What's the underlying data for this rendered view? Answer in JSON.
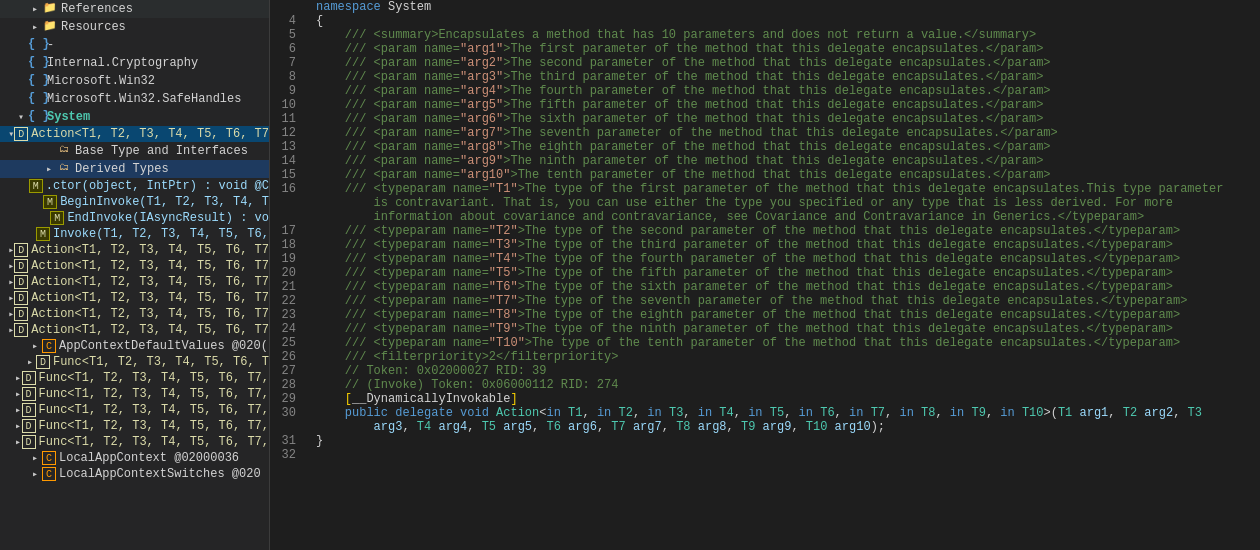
{
  "leftPanel": {
    "items": [
      {
        "id": "references",
        "label": "References",
        "indent": 2,
        "arrow": "collapsed",
        "icon": "folder",
        "iconColor": "folder"
      },
      {
        "id": "resources",
        "label": "Resources",
        "indent": 2,
        "arrow": "collapsed",
        "icon": "folder",
        "iconColor": "folder"
      },
      {
        "id": "braces1",
        "label": "{ } -",
        "indent": 1,
        "arrow": "leaf",
        "icon": "ns",
        "iconColor": "namespace"
      },
      {
        "id": "internal-crypto",
        "label": "Internal.Cryptography",
        "indent": 1,
        "arrow": "leaf",
        "icon": "ns",
        "iconColor": "namespace"
      },
      {
        "id": "microsoft-win32",
        "label": "Microsoft.Win32",
        "indent": 1,
        "arrow": "leaf",
        "icon": "ns",
        "iconColor": "namespace"
      },
      {
        "id": "microsoft-win32-safe",
        "label": "Microsoft.Win32.SafeHandles",
        "indent": 1,
        "arrow": "leaf",
        "icon": "ns",
        "iconColor": "namespace"
      },
      {
        "id": "system",
        "label": "System",
        "indent": 1,
        "arrow": "expanded",
        "icon": "ns",
        "iconColor": "namespace",
        "bold": true
      },
      {
        "id": "action-t10",
        "label": "Action<T1, T2, T3, T4, T5, T6, T7",
        "indent": 2,
        "arrow": "expanded",
        "icon": "delegate",
        "iconColor": "delegate",
        "selected": true
      },
      {
        "id": "base-type",
        "label": "Base Type and Interfaces",
        "indent": 3,
        "arrow": "leaf",
        "icon": "folder-sm",
        "iconColor": "folder"
      },
      {
        "id": "derived-types",
        "label": "Derived Types",
        "indent": 3,
        "arrow": "collapsed",
        "icon": "folder-sm",
        "iconColor": "folder",
        "selected-highlight": true
      },
      {
        "id": "ctor",
        "label": ".ctor(object, IntPtr) : void @C",
        "indent": 3,
        "arrow": "leaf",
        "icon": "method-blue",
        "iconColor": "method"
      },
      {
        "id": "begin-invoke",
        "label": "BeginInvoke(T1, T2, T3, T4, T",
        "indent": 3,
        "arrow": "leaf",
        "icon": "method-blue",
        "iconColor": "method"
      },
      {
        "id": "end-invoke",
        "label": "EndInvoke(IAsyncResult) : vo",
        "indent": 3,
        "arrow": "leaf",
        "icon": "method-blue",
        "iconColor": "method"
      },
      {
        "id": "invoke",
        "label": "Invoke(T1, T2, T3, T4, T5, T6,",
        "indent": 3,
        "arrow": "leaf",
        "icon": "method-blue",
        "iconColor": "method"
      },
      {
        "id": "action-t10b",
        "label": "Action<T1, T2, T3, T4, T5, T6, T7",
        "indent": 2,
        "arrow": "collapsed",
        "icon": "delegate",
        "iconColor": "delegate"
      },
      {
        "id": "action-t10c",
        "label": "Action<T1, T2, T3, T4, T5, T6, T7",
        "indent": 2,
        "arrow": "collapsed",
        "icon": "delegate",
        "iconColor": "delegate"
      },
      {
        "id": "action-t10d",
        "label": "Action<T1, T2, T3, T4, T5, T6, T7",
        "indent": 2,
        "arrow": "collapsed",
        "icon": "delegate",
        "iconColor": "delegate"
      },
      {
        "id": "action-t10e",
        "label": "Action<T1, T2, T3, T4, T5, T6, T7",
        "indent": 2,
        "arrow": "collapsed",
        "icon": "delegate",
        "iconColor": "delegate"
      },
      {
        "id": "action-t10f",
        "label": "Action<T1, T2, T3, T4, T5, T6, T7",
        "indent": 2,
        "arrow": "collapsed",
        "icon": "delegate",
        "iconColor": "delegate"
      },
      {
        "id": "action-t10g",
        "label": "Action<T1, T2, T3, T4, T5, T6, T7",
        "indent": 2,
        "arrow": "collapsed",
        "icon": "delegate",
        "iconColor": "delegate"
      },
      {
        "id": "app-context-values",
        "label": "AppContextDefaultValues @020(",
        "indent": 2,
        "arrow": "collapsed",
        "icon": "class-orange",
        "iconColor": "class"
      },
      {
        "id": "func-t10a",
        "label": "Func<T1, T2, T3, T4, T5, T6, T",
        "indent": 2,
        "arrow": "collapsed",
        "icon": "delegate",
        "iconColor": "delegate"
      },
      {
        "id": "func-t10b",
        "label": "Func<T1, T2, T3, T4, T5, T6, T7,",
        "indent": 2,
        "arrow": "collapsed",
        "icon": "delegate",
        "iconColor": "delegate"
      },
      {
        "id": "func-t10c",
        "label": "Func<T1, T2, T3, T4, T5, T6, T7,",
        "indent": 2,
        "arrow": "collapsed",
        "icon": "delegate",
        "iconColor": "delegate"
      },
      {
        "id": "func-t10d",
        "label": "Func<T1, T2, T3, T4, T5, T6, T7,",
        "indent": 2,
        "arrow": "collapsed",
        "icon": "delegate",
        "iconColor": "delegate"
      },
      {
        "id": "func-t10e",
        "label": "Func<T1, T2, T3, T4, T5, T6, T7,",
        "indent": 2,
        "arrow": "collapsed",
        "icon": "delegate",
        "iconColor": "delegate"
      },
      {
        "id": "func-t10f",
        "label": "Func<T1, T2, T3, T4, T5, T6, T7,",
        "indent": 2,
        "arrow": "collapsed",
        "icon": "delegate",
        "iconColor": "delegate"
      },
      {
        "id": "local-app-context",
        "label": "LocalAppContext @02000036",
        "indent": 2,
        "arrow": "collapsed",
        "icon": "class-orange",
        "iconColor": "class"
      },
      {
        "id": "local-app-context-sw",
        "label": "LocalAppContextSwitches @020",
        "indent": 2,
        "arrow": "collapsed",
        "icon": "class-orange",
        "iconColor": "class"
      }
    ]
  },
  "codePanel": {
    "firstLineNum": 4,
    "lines": [
      {
        "num": 4,
        "content": "{"
      },
      {
        "num": 5,
        "content": "    /// <summary>Encapsulates a method that has 10 parameters and does not return a value.</summary>"
      },
      {
        "num": 6,
        "content": "    /// <param name=\"arg1\">The first parameter of the method that this delegate encapsulates.</param>"
      },
      {
        "num": 7,
        "content": "    /// <param name=\"arg2\">The second parameter of the method that this delegate encapsulates.</param>"
      },
      {
        "num": 8,
        "content": "    /// <param name=\"arg3\">The third parameter of the method that this delegate encapsulates.</param>"
      },
      {
        "num": 9,
        "content": "    /// <param name=\"arg4\">The fourth parameter of the method that this delegate encapsulates.</param>"
      },
      {
        "num": 10,
        "content": "    /// <param name=\"arg5\">The fifth parameter of the method that this delegate encapsulates.</param>"
      },
      {
        "num": 11,
        "content": "    /// <param name=\"arg6\">The sixth parameter of the method that this delegate encapsulates.</param>"
      },
      {
        "num": 12,
        "content": "    /// <param name=\"arg7\">The seventh parameter of the method that this delegate encapsulates.</param>"
      },
      {
        "num": 13,
        "content": "    /// <param name=\"arg8\">The eighth parameter of the method that this delegate encapsulates.</param>"
      },
      {
        "num": 14,
        "content": "    /// <param name=\"arg9\">The ninth parameter of the method that this delegate encapsulates.</param>"
      },
      {
        "num": 15,
        "content": "    /// <param name=\"arg10\">The tenth parameter of the method that this delegate encapsulates.</param>"
      },
      {
        "num": 16,
        "content": "    /// <typeparam name=\"T1\">The type of the first parameter of the method that this delegate encapsulates.This type parameter"
      },
      {
        "num": null,
        "content": "        is contravariant. That is, you can use either the type you specified or any type that is less derived. For more"
      },
      {
        "num": null,
        "content": "        information about covariance and contravariance, see Covariance and Contravariance in Generics.</typeparam>"
      },
      {
        "num": 17,
        "content": "    /// <typeparam name=\"T2\">The type of the second parameter of the method that this delegate encapsulates.</typeparam>"
      },
      {
        "num": 18,
        "content": "    /// <typeparam name=\"T3\">The type of the third parameter of the method that this delegate encapsulates.</typeparam>"
      },
      {
        "num": 19,
        "content": "    /// <typeparam name=\"T4\">The type of the fourth parameter of the method that this delegate encapsulates.</typeparam>"
      },
      {
        "num": 20,
        "content": "    /// <typeparam name=\"T5\">The type of the fifth parameter of the method that this delegate encapsulates.</typeparam>"
      },
      {
        "num": 21,
        "content": "    /// <typeparam name=\"T6\">The type of the sixth parameter of the method that this delegate encapsulates.</typeparam>"
      },
      {
        "num": 22,
        "content": "    /// <typeparam name=\"T7\">The type of the seventh parameter of the method that this delegate encapsulates.</typeparam>"
      },
      {
        "num": 23,
        "content": "    /// <typeparam name=\"T8\">The type of the eighth parameter of the method that this delegate encapsulates.</typeparam>"
      },
      {
        "num": 24,
        "content": "    /// <typeparam name=\"T9\">The type of the ninth parameter of the method that this delegate encapsulates.</typeparam>"
      },
      {
        "num": 25,
        "content": "    /// <typeparam name=\"T10\">The type of the tenth parameter of the method that this delegate encapsulates.</typeparam>"
      },
      {
        "num": 26,
        "content": "    /// <filterpriority>2</filterpriority>"
      },
      {
        "num": 27,
        "content": "    // Token: 0x02000027 RID: 39"
      },
      {
        "num": 28,
        "content": "    // (Invoke) Token: 0x06000112 RID: 274"
      },
      {
        "num": 29,
        "content": "    [__DynamicallyInvokable]"
      },
      {
        "num": 30,
        "content": "    public delegate void Action<in T1, in T2, in T3, in T4, in T5, in T6, in T7, in T8, in T9, in T10>(T1 arg1, T2 arg2, T3"
      },
      {
        "num": null,
        "content": "        arg3, T4 arg4, T5 arg5, T6 arg6, T7 arg7, T8 arg8, T9 arg9, T10 arg10);"
      },
      {
        "num": 31,
        "content": "}"
      },
      {
        "num": 32,
        "content": ""
      }
    ]
  }
}
